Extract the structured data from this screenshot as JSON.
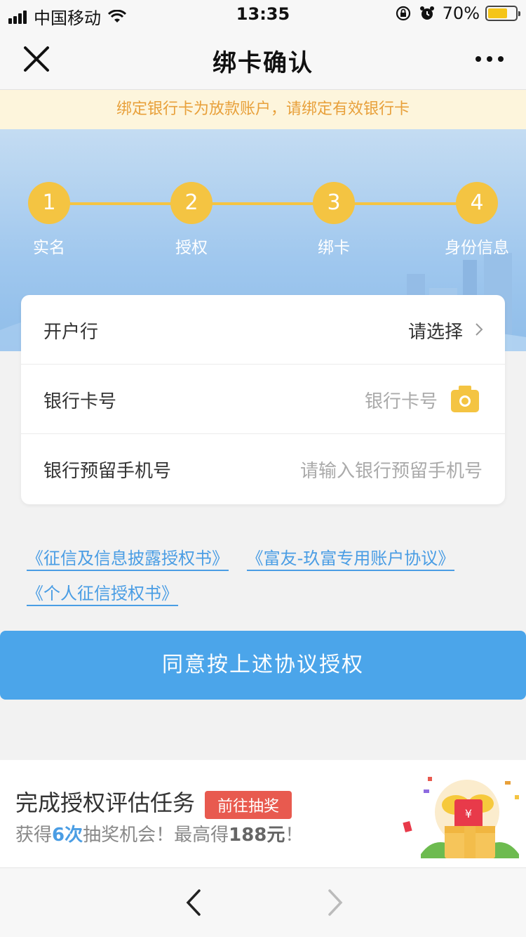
{
  "status_bar": {
    "carrier": "中国移动",
    "time": "13:35",
    "battery_percent": "70%",
    "battery_level": 0.7,
    "icons": [
      "signal-icon",
      "wifi-icon",
      "rotation-lock-icon",
      "alarm-icon",
      "battery-icon"
    ]
  },
  "nav": {
    "title": "绑卡确认",
    "close_icon": "close-icon",
    "more_icon": "more-icon"
  },
  "notice": {
    "text": "绑定银行卡为放款账户，请绑定有效银行卡"
  },
  "steps": [
    {
      "num": "1",
      "label": "实名"
    },
    {
      "num": "2",
      "label": "授权"
    },
    {
      "num": "3",
      "label": "绑卡"
    },
    {
      "num": "4",
      "label": "身份信息"
    }
  ],
  "form": {
    "bank": {
      "label": "开户行",
      "value": "请选择"
    },
    "card_number": {
      "label": "银行卡号",
      "placeholder": "银行卡号"
    },
    "phone": {
      "label": "银行预留手机号",
      "placeholder": "请输入银行预留手机号"
    }
  },
  "links": [
    "《征信及信息披露授权书》",
    "《富友-玖富专用账户协议》",
    "《个人征信授权书》"
  ],
  "agree_button": "同意按上述协议授权",
  "promo": {
    "title": "完成授权评估任务",
    "badge": "前往抽奖",
    "sub_prefix": "获得",
    "sub_count": "6次",
    "sub_middle": "抽奖机会！最高得",
    "sub_amount": "188元",
    "sub_suffix": "！"
  },
  "colors": {
    "accent": "#4ba5ea",
    "step": "#f4c442",
    "notice_text": "#e8a03a",
    "notice_bg": "#fdf5dc",
    "badge": "#e85a4f"
  }
}
